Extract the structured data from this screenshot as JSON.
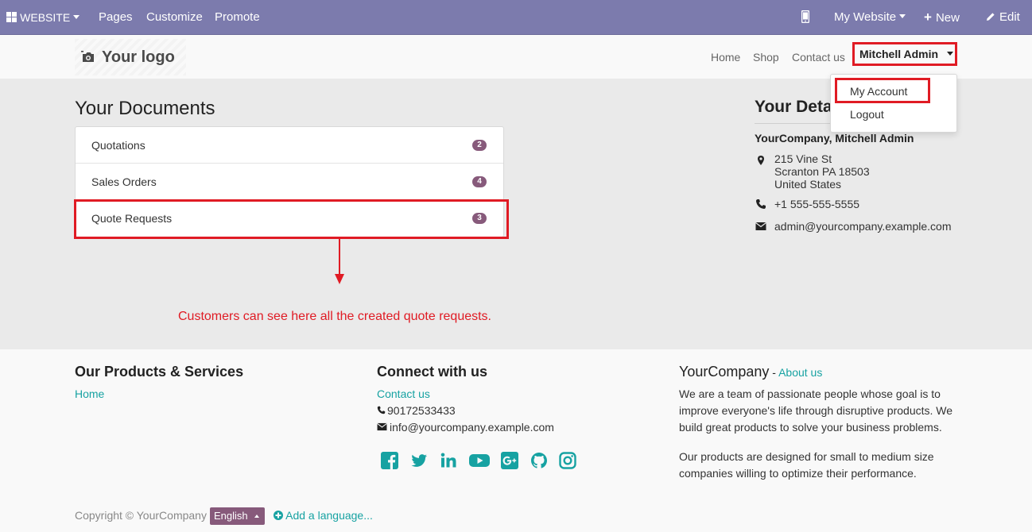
{
  "admin_bar": {
    "website_label": "WEBSITE",
    "pages_label": "Pages",
    "customize_label": "Customize",
    "promote_label": "Promote",
    "my_website_label": "My Website",
    "new_label": "New",
    "edit_label": "Edit"
  },
  "header": {
    "logo_text": "Your logo",
    "nav": [
      "Home",
      "Shop",
      "Contact us"
    ],
    "user_name": "Mitchell Admin"
  },
  "user_dropdown": {
    "items": [
      "My Account",
      "Logout"
    ]
  },
  "documents": {
    "title": "Your Documents",
    "rows": [
      {
        "label": "Quotations",
        "count": "2"
      },
      {
        "label": "Sales Orders",
        "count": "4"
      },
      {
        "label": "Quote Requests",
        "count": "3"
      }
    ],
    "annotation": "Customers can see here all the created quote requests."
  },
  "details": {
    "title": "Your Details",
    "company": "YourCompany, Mitchell Admin",
    "address_line1": "215 Vine St",
    "address_line2": "Scranton PA 18503",
    "address_line3": "United States",
    "phone": "+1 555-555-5555",
    "email": "admin@yourcompany.example.com"
  },
  "footer": {
    "products_title": "Our Products & Services",
    "products_link": "Home",
    "connect_title": "Connect with us",
    "contact_link": "Contact us",
    "phone": "90172533433",
    "email": "info@yourcompany.example.com",
    "company_title": "YourCompany",
    "company_separator": " - ",
    "about_link": "About us",
    "about_para1": "We are a team of passionate people whose goal is to improve everyone's life through disruptive products. We build great products to solve your business problems.",
    "about_para2": "Our products are designed for small to medium size companies willing to optimize their performance.",
    "social": [
      "facebook",
      "twitter",
      "linkedin",
      "youtube",
      "google-plus",
      "github",
      "instagram"
    ],
    "copyright": "Copyright © YourCompany",
    "language": "English",
    "add_language": "Add a language..."
  },
  "colors": {
    "admin_bar": "#7c7bad",
    "brand": "#875a7b",
    "link": "#17a2a2",
    "annotation": "#e01b24"
  }
}
